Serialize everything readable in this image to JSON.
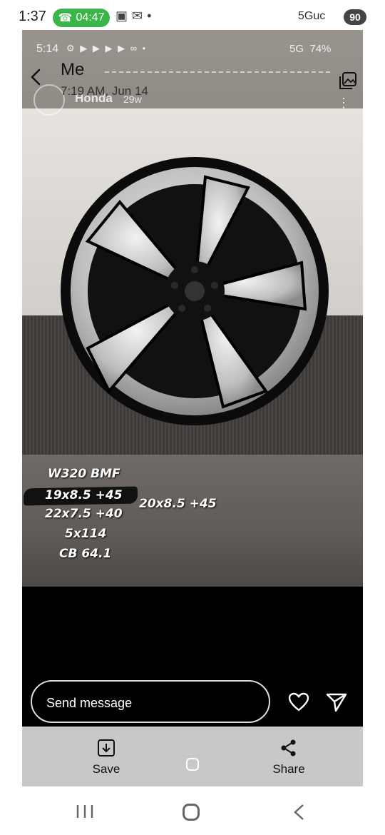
{
  "outer_status": {
    "time": "1:37",
    "call_time": "04:47",
    "signal": "5Guc",
    "battery": "90"
  },
  "inner_status": {
    "time": "5:14",
    "signal": "5G",
    "battery": "74%"
  },
  "story": {
    "name": "Me",
    "time": "7:19 AM, Jun 14",
    "ghost_account": "Honda",
    "ghost_age": "29w"
  },
  "spec_text": {
    "model": "W320 BMF",
    "size1": "19x8.5 +45",
    "size2": "22x7.5 +40",
    "size3": "20x8.5 +45",
    "bolt": "5x114",
    "center_bore": "CB 64.1"
  },
  "reply": {
    "placeholder": "Send message"
  },
  "actions": {
    "save_label": "Save",
    "share_label": "Share"
  },
  "icons": [
    "phone-icon",
    "back-arrow-icon",
    "gallery-icon",
    "heart-icon",
    "send-icon",
    "save-download-icon",
    "share-icon",
    "nav-recent-icon",
    "nav-home-icon",
    "nav-back-icon"
  ],
  "colors": {
    "call_pill": "#3bb54a",
    "action_bar": "#c8c8c8"
  }
}
